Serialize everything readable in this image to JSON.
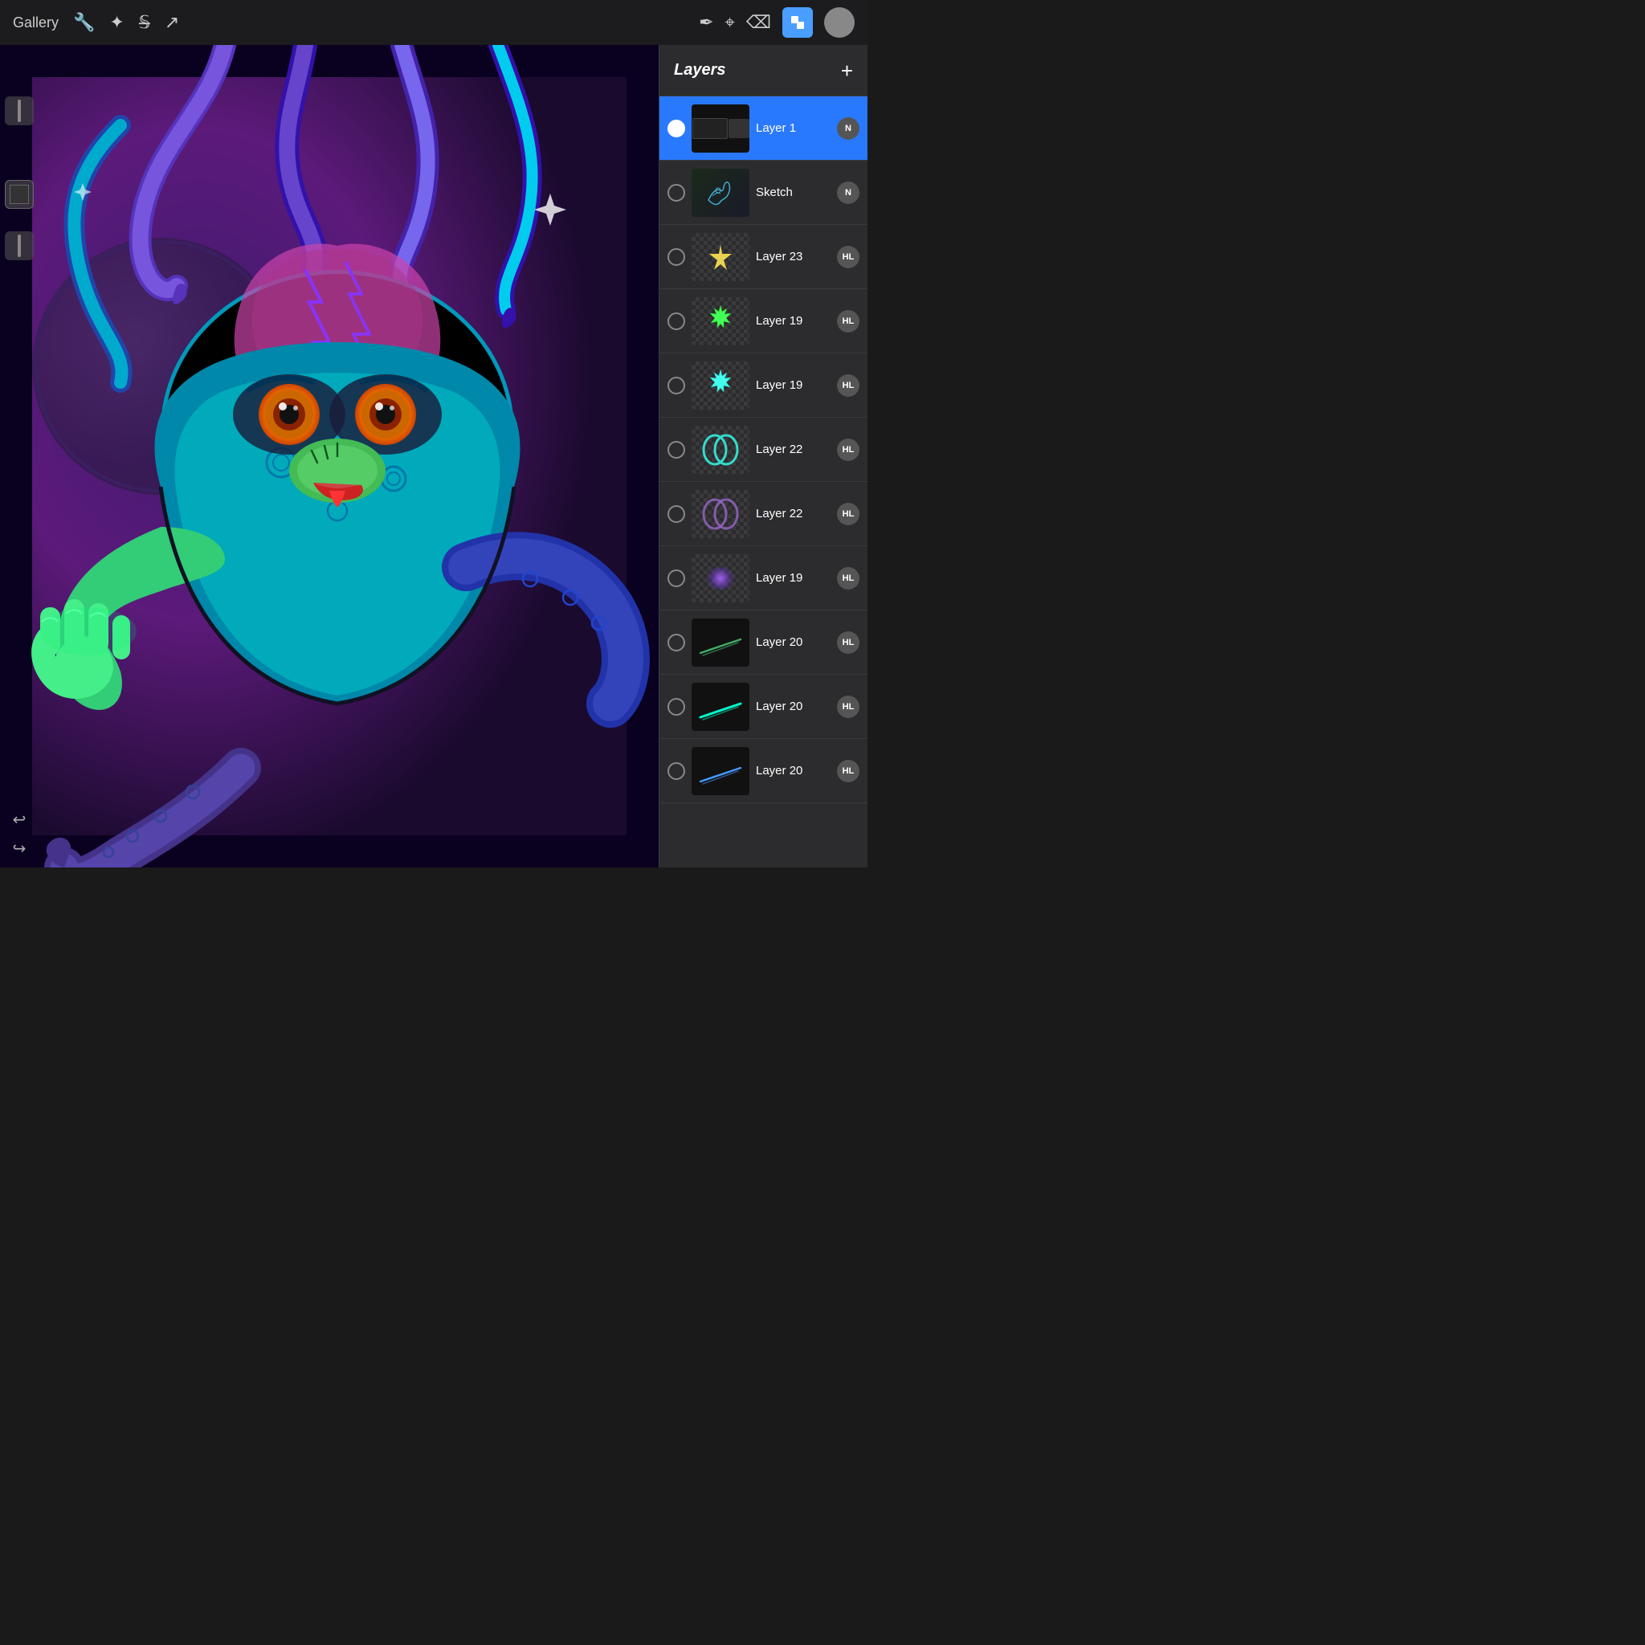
{
  "toolbar": {
    "gallery_label": "Gallery",
    "tools": [
      "wrench",
      "magic",
      "strikethrough",
      "arrow"
    ],
    "right_tools": [
      "pen-nib",
      "brush",
      "eraser",
      "layers-blue",
      "profile"
    ]
  },
  "layers_panel": {
    "title": "Layers",
    "add_button": "+",
    "items": [
      {
        "id": "layer1",
        "name": "Layer 1",
        "badge": "N",
        "visible": true,
        "active": true,
        "thumb_type": "dark_rect"
      },
      {
        "id": "sketch",
        "name": "Sketch",
        "badge": "N",
        "visible": false,
        "active": false,
        "thumb_type": "sketch"
      },
      {
        "id": "layer23",
        "name": "Layer 23",
        "badge": "HL",
        "visible": true,
        "active": false,
        "thumb_type": "star_gold"
      },
      {
        "id": "layer19a",
        "name": "Layer 19",
        "badge": "HL",
        "visible": true,
        "active": false,
        "thumb_type": "star_green"
      },
      {
        "id": "layer19b",
        "name": "Layer 19",
        "badge": "HL",
        "visible": true,
        "active": false,
        "thumb_type": "star_cyan"
      },
      {
        "id": "layer22a",
        "name": "Layer 22",
        "badge": "HL",
        "visible": true,
        "active": false,
        "thumb_type": "ring_teal"
      },
      {
        "id": "layer22b",
        "name": "Layer 22",
        "badge": "HL",
        "visible": true,
        "active": false,
        "thumb_type": "ring_purple"
      },
      {
        "id": "layer19c",
        "name": "Layer 19",
        "badge": "HL",
        "visible": true,
        "active": false,
        "thumb_type": "glow_purple"
      },
      {
        "id": "layer20a",
        "name": "Layer 20",
        "badge": "HL",
        "visible": true,
        "active": false,
        "thumb_type": "lines_dark"
      },
      {
        "id": "layer20b",
        "name": "Layer 20",
        "badge": "HL",
        "visible": true,
        "active": false,
        "thumb_type": "lines_cyan"
      },
      {
        "id": "layer20c",
        "name": "Layer 20",
        "badge": "HL",
        "visible": true,
        "active": false,
        "thumb_type": "lines_blue"
      }
    ]
  },
  "canvas": {
    "description": "Digital art: alien octopus creature"
  }
}
